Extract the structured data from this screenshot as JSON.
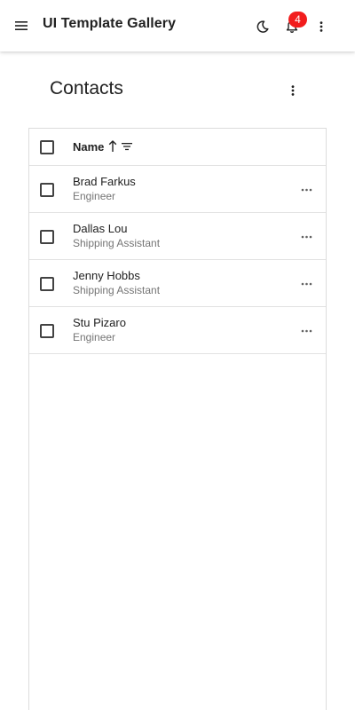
{
  "appbar": {
    "title": "UI Template Gallery",
    "notification_count": "4",
    "badge_color": "#f21d1d",
    "icons": [
      "menu-icon",
      "moon-icon",
      "bell-icon",
      "more-vert-icon"
    ]
  },
  "page": {
    "title": "Contacts"
  },
  "table": {
    "column_name": "Name",
    "sort": "ascending",
    "rows": [
      {
        "name": "Brad Farkus",
        "role": "Engineer"
      },
      {
        "name": "Dallas Lou",
        "role": "Shipping Assistant"
      },
      {
        "name": "Jenny Hobbs",
        "role": "Shipping Assistant"
      },
      {
        "name": "Stu Pizaro",
        "role": "Engineer"
      }
    ]
  }
}
